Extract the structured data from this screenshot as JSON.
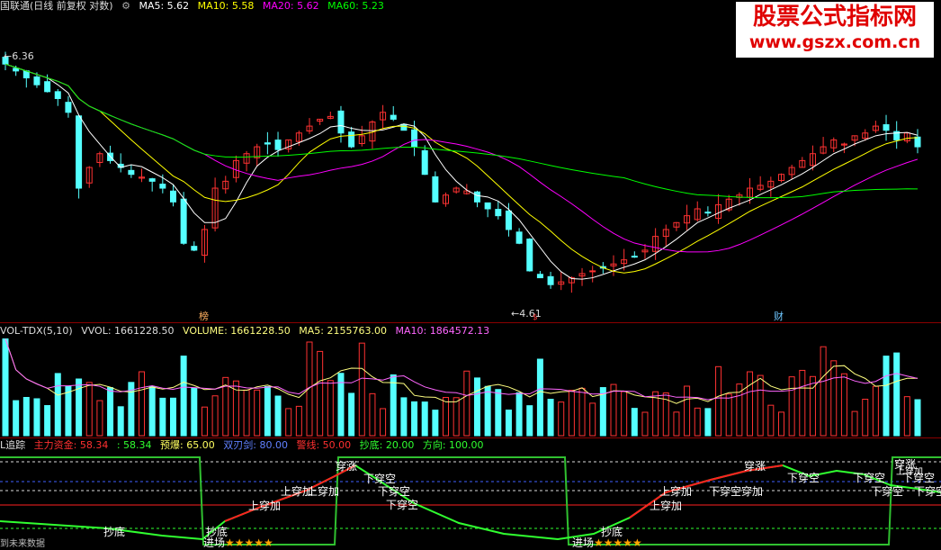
{
  "price_header": {
    "title": "国联通(日线 前复权 对数)",
    "ma5": "MA5: 5.62",
    "ma10": "MA10: 5.58",
    "ma20": "MA20: 5.62",
    "ma60": "MA60: 5.23",
    "colors": {
      "ma5": "#ffffff",
      "ma10": "#ffff00",
      "ma20": "#ff00ff",
      "ma60": "#00ff00"
    }
  },
  "watermark": {
    "title": "股票公式指标网",
    "url": "www.gszx.com.cn"
  },
  "price_labels": {
    "high": "6.36",
    "low": "4.61",
    "badge_left": "榜",
    "badge_right": "财",
    "badge_mid": "$"
  },
  "vol_header": {
    "name": "VOL-TDX(5,10)",
    "vvol": "VVOL: 1661228.50",
    "volume": "VOLUME: 1661228.50",
    "ma5": "MA5: 2155763.00",
    "ma10": "MA10: 1864572.13"
  },
  "ind_header": {
    "name": "L追踪",
    "main_fund": "主力资金: 58.34",
    "val2": ": 58.34",
    "yubao": "预爆: 65.00",
    "shuangren": "双刃剑: 80.00",
    "sixian": "警线: 50.00",
    "chaodi": "抄底: 20.00",
    "fangxiang": "方向: 100.00"
  },
  "signals": [
    {
      "text": "穿涨"
    },
    {
      "text": "上穿加"
    },
    {
      "text": "上穿加"
    },
    {
      "text": "上穿加"
    },
    {
      "text": "下穿空"
    },
    {
      "text": "下穿空"
    },
    {
      "text": "下穿空"
    },
    {
      "text": "抄底"
    },
    {
      "text": "抄底"
    },
    {
      "text": "进场"
    },
    {
      "text": "抄底"
    },
    {
      "text": "进场"
    },
    {
      "text": "上穿加"
    },
    {
      "text": "上穿加"
    },
    {
      "text": "下穿空穿加"
    },
    {
      "text": "穿涨"
    },
    {
      "text": "下穿空"
    },
    {
      "text": "下穿空"
    },
    {
      "text": "穿涨"
    },
    {
      "text": "下穿空"
    },
    {
      "text": "下穿空"
    },
    {
      "text": "下穿空"
    },
    {
      "text": "上穿加"
    }
  ],
  "stars": "★★★★★",
  "bottom_text": "到未来数据",
  "chart_data": {
    "type": "candlestick",
    "price_range": [
      4.61,
      6.36
    ],
    "close": [
      6.3,
      6.25,
      6.2,
      6.15,
      6.1,
      6.05,
      5.95,
      5.4,
      5.55,
      5.65,
      5.6,
      5.55,
      5.5,
      5.48,
      5.45,
      5.4,
      5.3,
      5.0,
      4.95,
      5.1,
      5.4,
      5.45,
      5.6,
      5.65,
      5.7,
      5.72,
      5.68,
      5.75,
      5.8,
      5.85,
      5.9,
      5.92,
      5.8,
      5.7,
      5.78,
      5.88,
      5.95,
      5.9,
      5.82,
      5.7,
      5.5,
      5.3,
      5.35,
      5.4,
      5.38,
      5.3,
      5.25,
      5.2,
      5.1,
      5.0,
      4.8,
      4.75,
      4.7,
      4.72,
      4.75,
      4.78,
      4.8,
      4.82,
      4.85,
      4.88,
      4.9,
      4.95,
      5.05,
      5.1,
      5.15,
      5.2,
      5.25,
      5.22,
      5.28,
      5.32,
      5.35,
      5.4,
      5.42,
      5.45,
      5.5,
      5.55,
      5.6,
      5.65,
      5.7,
      5.75,
      5.72,
      5.78,
      5.8,
      5.85,
      5.82,
      5.75,
      5.8,
      5.7
    ],
    "volume_ma_visible": true
  }
}
